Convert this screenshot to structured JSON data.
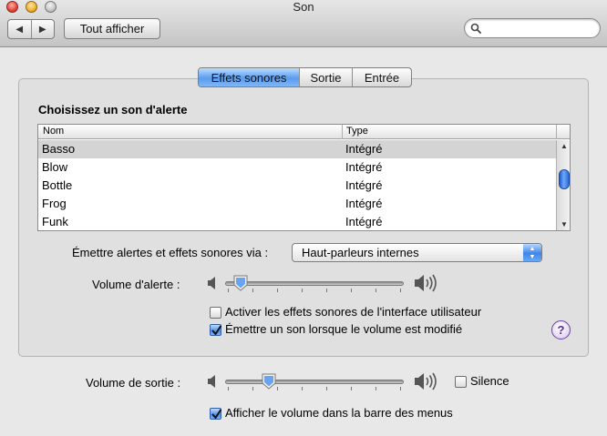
{
  "window": {
    "title": "Son"
  },
  "toolbar": {
    "show_all": "Tout afficher",
    "back_glyph": "◀",
    "forward_glyph": "▶",
    "search_placeholder": ""
  },
  "tabs": [
    {
      "label": "Effets sonores",
      "active": true
    },
    {
      "label": "Sortie",
      "active": false
    },
    {
      "label": "Entrée",
      "active": false
    }
  ],
  "alerts": {
    "title": "Choisissez un son d'alerte",
    "columns": {
      "name": "Nom",
      "type": "Type"
    },
    "rows": [
      {
        "name": "Basso",
        "type": "Intégré",
        "selected": true
      },
      {
        "name": "Blow",
        "type": "Intégré",
        "selected": false
      },
      {
        "name": "Bottle",
        "type": "Intégré",
        "selected": false
      },
      {
        "name": "Frog",
        "type": "Intégré",
        "selected": false
      },
      {
        "name": "Funk",
        "type": "Intégré",
        "selected": false
      }
    ]
  },
  "output_via": {
    "label": "Émettre alertes et effets sonores via :",
    "value": "Haut-parleurs internes"
  },
  "alert_volume": {
    "label": "Volume d'alerte :",
    "level": 0.05
  },
  "checkboxes": {
    "ui_effects": {
      "label": "Activer les effets sonores de l'interface utilisateur",
      "checked": false
    },
    "volume_feedback": {
      "label": "Émettre un son lorsque le volume est modifié",
      "checked": true
    }
  },
  "help": {
    "glyph": "?"
  },
  "output_volume": {
    "label": "Volume de sortie :",
    "level": 0.22
  },
  "mute": {
    "label": "Silence",
    "checked": false
  },
  "menubar_volume": {
    "label": "Afficher le volume dans la barre des menus",
    "checked": true
  },
  "colors": {
    "accent": "#5a9cef",
    "selection": "#d4d4d4"
  }
}
